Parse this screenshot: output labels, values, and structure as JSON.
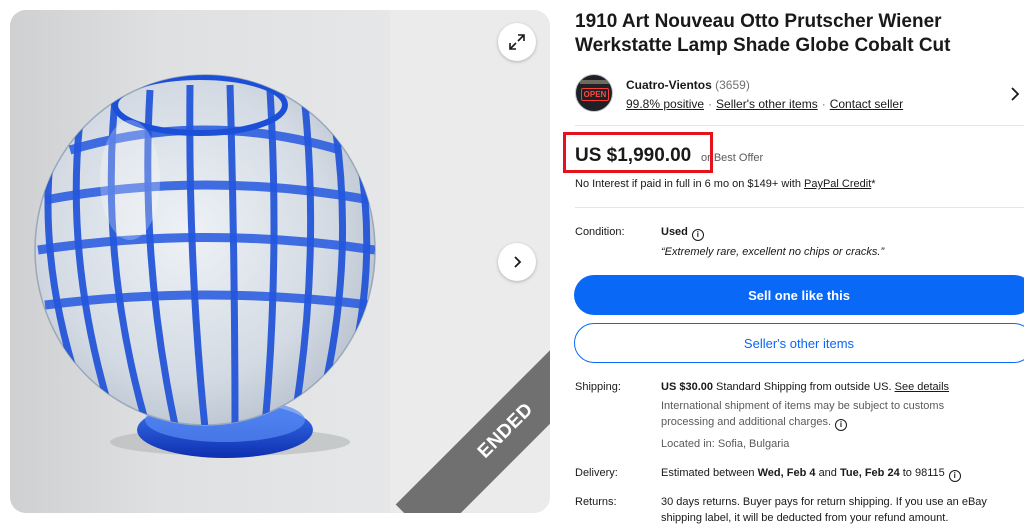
{
  "listing": {
    "title": "1910 Art Nouveau Otto Prutscher Wiener Werkstatte Lamp Shade Globe Cobalt Cut",
    "ended_label": "ENDED"
  },
  "seller": {
    "name": "Cuatro-Vientos",
    "feedback_count": "(3659)",
    "positive": "99.8% positive",
    "other_items_link": "Seller's other items",
    "contact_link": "Contact seller",
    "avatar_sign": "OPEN"
  },
  "price": {
    "amount": "US $1,990.00",
    "best_offer": "or Best Offer",
    "financing_text": "No Interest if paid in full in 6 mo on $149+ with",
    "financing_link": "PayPal Credit",
    "financing_suffix": "*"
  },
  "condition": {
    "label": "Condition:",
    "value": "Used",
    "note": "“Extremely rare, excellent no chips or cracks.”"
  },
  "actions": {
    "sell_like_this": "Sell one like this",
    "sellers_other_items": "Seller's other items"
  },
  "shipping": {
    "label": "Shipping:",
    "cost": "US $30.00",
    "method": "Standard Shipping from outside US.",
    "details_link": "See details",
    "intl_note": "International shipment of items may be subject to customs processing and additional charges.",
    "location": "Located in: Sofia, Bulgaria"
  },
  "delivery": {
    "label": "Delivery:",
    "prefix": "Estimated between",
    "start": "Wed, Feb 4",
    "and": "and",
    "end": "Tue, Feb 24",
    "to": "to 98115"
  },
  "returns": {
    "label": "Returns:",
    "text": "30 days returns. Buyer pays for return shipping. If you use an eBay shipping label, it will be deducted from your refund amount."
  },
  "colors": {
    "accent_blue": "#0968f6",
    "highlight_red": "#e3121b",
    "ribbon_gray": "#707070",
    "glass_blue": "#1c4fd8"
  }
}
